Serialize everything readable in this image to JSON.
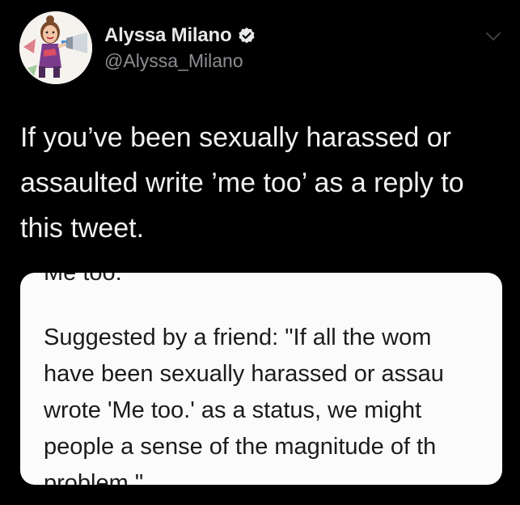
{
  "tweet": {
    "author": {
      "display_name": "Alyssa Milano",
      "handle": "@Alyssa_Milano",
      "verified": true,
      "avatar_icon": "caricature-avatar-icon"
    },
    "menu_icon": "chevron-down-icon",
    "text_lines": [
      "If you’ve been sexually harassed or",
      "assaulted write ’me too’ as a reply to",
      "this tweet."
    ],
    "media": {
      "top_line": "Me too.",
      "lines": [
        "Suggested by a friend: \"If all the wom",
        "have been sexually harassed or assau",
        "wrote 'Me too.' as a status, we might",
        "people a sense of the magnitude of th",
        "problem.\""
      ]
    }
  },
  "colors": {
    "background": "#000000",
    "name": "#e7e9ea",
    "handle": "#8b8e92",
    "body_text": "#f1f1f1",
    "card_bg": "#fbfbfb",
    "card_text": "#1b1b1b"
  }
}
